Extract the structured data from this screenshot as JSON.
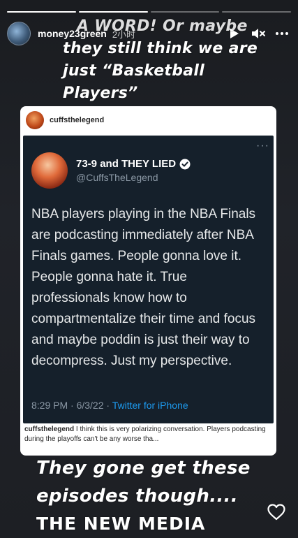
{
  "story": {
    "progress_segments": 4,
    "active_segment": 1
  },
  "header": {
    "username": "money23green",
    "time": "2小时"
  },
  "top_text": {
    "line1": "A WORD! Or maybe",
    "line2": "they still think we are",
    "line3": "just “Basketball",
    "line4": "Players”"
  },
  "card": {
    "username": "cuffsthelegend",
    "tweet": {
      "name": "73-9 and THEY LIED",
      "handle": "@CuffsTheLegend",
      "text": "NBA players playing in the NBA Finals are podcasting immediately after NBA Finals games. People gonna love it. People gonna hate it.  True professionals know how to compartmentalize their time and focus and maybe poddin is just their way to decompress. Just my perspective.",
      "time": "8:29 PM · 6/3/22 · ",
      "source": "Twitter for iPhone"
    },
    "caption_user": "cuffsthelegend",
    "caption_text": "I think this is very polarizing conversation. Players podcasting during the playoffs can't be any worse tha..."
  },
  "bottom_text": {
    "line1": "They gone get these",
    "line2": "episodes though....",
    "line3": "THE NEW MEDIA"
  },
  "icons": {
    "play": "play-icon",
    "mute": "mute-icon",
    "more": "more-icon",
    "heart": "heart-icon"
  }
}
